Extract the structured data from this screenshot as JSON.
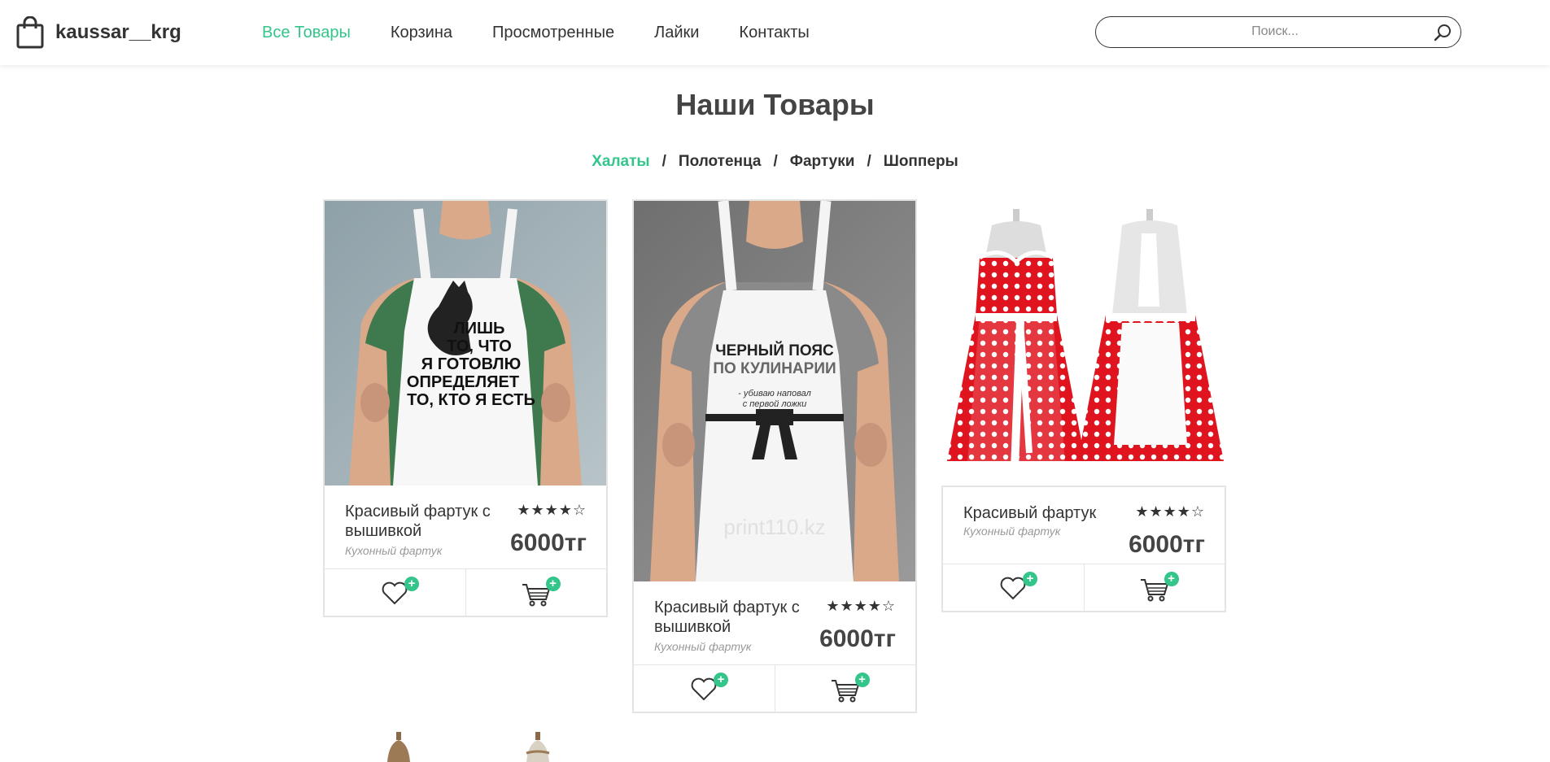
{
  "header": {
    "logo_text": "kaussar__krg",
    "nav": [
      {
        "label": "Все Товары",
        "active": true
      },
      {
        "label": "Корзина",
        "active": false
      },
      {
        "label": "Просмотренные",
        "active": false
      },
      {
        "label": "Лайки",
        "active": false
      },
      {
        "label": "Контакты",
        "active": false
      }
    ],
    "search_placeholder": "Поиск..."
  },
  "page_title": "Наши Товары",
  "categories": [
    {
      "label": "Халаты",
      "active": true
    },
    {
      "label": "Полотенца",
      "active": false
    },
    {
      "label": "Фартуки",
      "active": false
    },
    {
      "label": "Шопперы",
      "active": false
    }
  ],
  "separator": "/",
  "products": [
    {
      "name": "Красивый фартук с вышивкой",
      "subtitle": "Кухонный фартук",
      "rating": 4,
      "rating_max": 5,
      "stars": "★★★★☆",
      "price": "6000тг",
      "apron_text": [
        "ЛИШЬ",
        "ТО, ЧТО",
        "Я ГОТОВЛЮ",
        "ОПРЕДЕЛЯЕТ",
        "ТО, КТО Я ЕСТЬ"
      ]
    },
    {
      "name": "Красивый фартук с вышивкой",
      "subtitle": "Кухонный фартук",
      "rating": 4,
      "rating_max": 5,
      "stars": "★★★★☆",
      "price": "6000тг",
      "apron_text": [
        "ЧЕРНЫЙ ПОЯС",
        "ПО КУЛИНАРИИ",
        "- убиваю наповал",
        "с первой ложки"
      ],
      "watermark": "print110.kz"
    },
    {
      "name": "Красивый фартук",
      "subtitle": "Кухонный фартук",
      "rating": 4,
      "rating_max": 5,
      "stars": "★★★★☆",
      "price": "6000тг"
    }
  ],
  "plus_symbol": "+",
  "colors": {
    "accent": "#33c58a",
    "text": "#333333",
    "border": "#e4e4e4",
    "apron_red": "#e0141e"
  },
  "icons": {
    "logo": "shopping-bag-icon",
    "search": "search-icon",
    "like": "heart-icon",
    "cart": "cart-icon"
  }
}
